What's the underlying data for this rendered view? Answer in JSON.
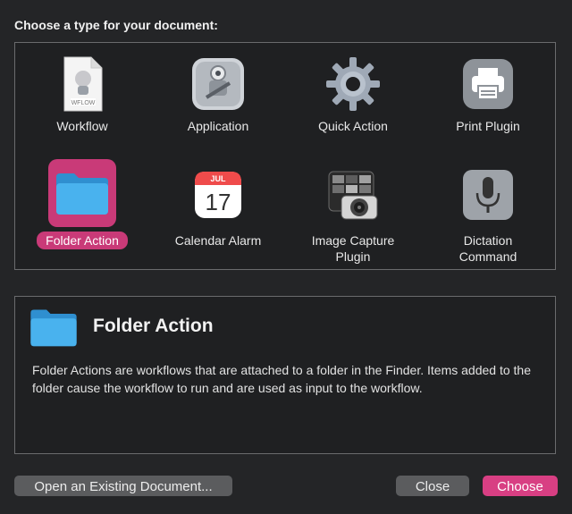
{
  "dialog": {
    "heading": "Choose a type for your document:"
  },
  "types": [
    {
      "id": "workflow",
      "label": "Workflow",
      "icon": "workflow-document-icon",
      "icon_text": "WFLOW"
    },
    {
      "id": "application",
      "label": "Application",
      "icon": "automator-robot-icon"
    },
    {
      "id": "quick-action",
      "label": "Quick Action",
      "icon": "gear-icon"
    },
    {
      "id": "print-plugin",
      "label": "Print Plugin",
      "icon": "printer-icon"
    },
    {
      "id": "folder-action",
      "label": "Folder Action",
      "icon": "folder-icon",
      "selected": true
    },
    {
      "id": "calendar-alarm",
      "label": "Calendar Alarm",
      "icon": "calendar-icon",
      "month": "JUL",
      "day": "17"
    },
    {
      "id": "image-capture-plugin",
      "label": "Image Capture Plugin",
      "line1": "Image Capture",
      "line2": "Plugin",
      "icon": "camera-photos-icon"
    },
    {
      "id": "dictation-command",
      "label": "Dictation Command",
      "line1": "Dictation",
      "line2": "Command",
      "icon": "microphone-icon"
    }
  ],
  "description": {
    "title": "Folder Action",
    "text": "Folder Actions are workflows that are attached to a folder in the Finder. Items added to the folder cause the workflow to run and are used as input to the workflow."
  },
  "buttons": {
    "open_existing": "Open an Existing Document...",
    "close": "Close",
    "choose": "Choose"
  },
  "colors": {
    "accent": "#d83f83",
    "selection": "#c93a78",
    "folder_blue": "#3aa9e6",
    "background": "#242527"
  }
}
